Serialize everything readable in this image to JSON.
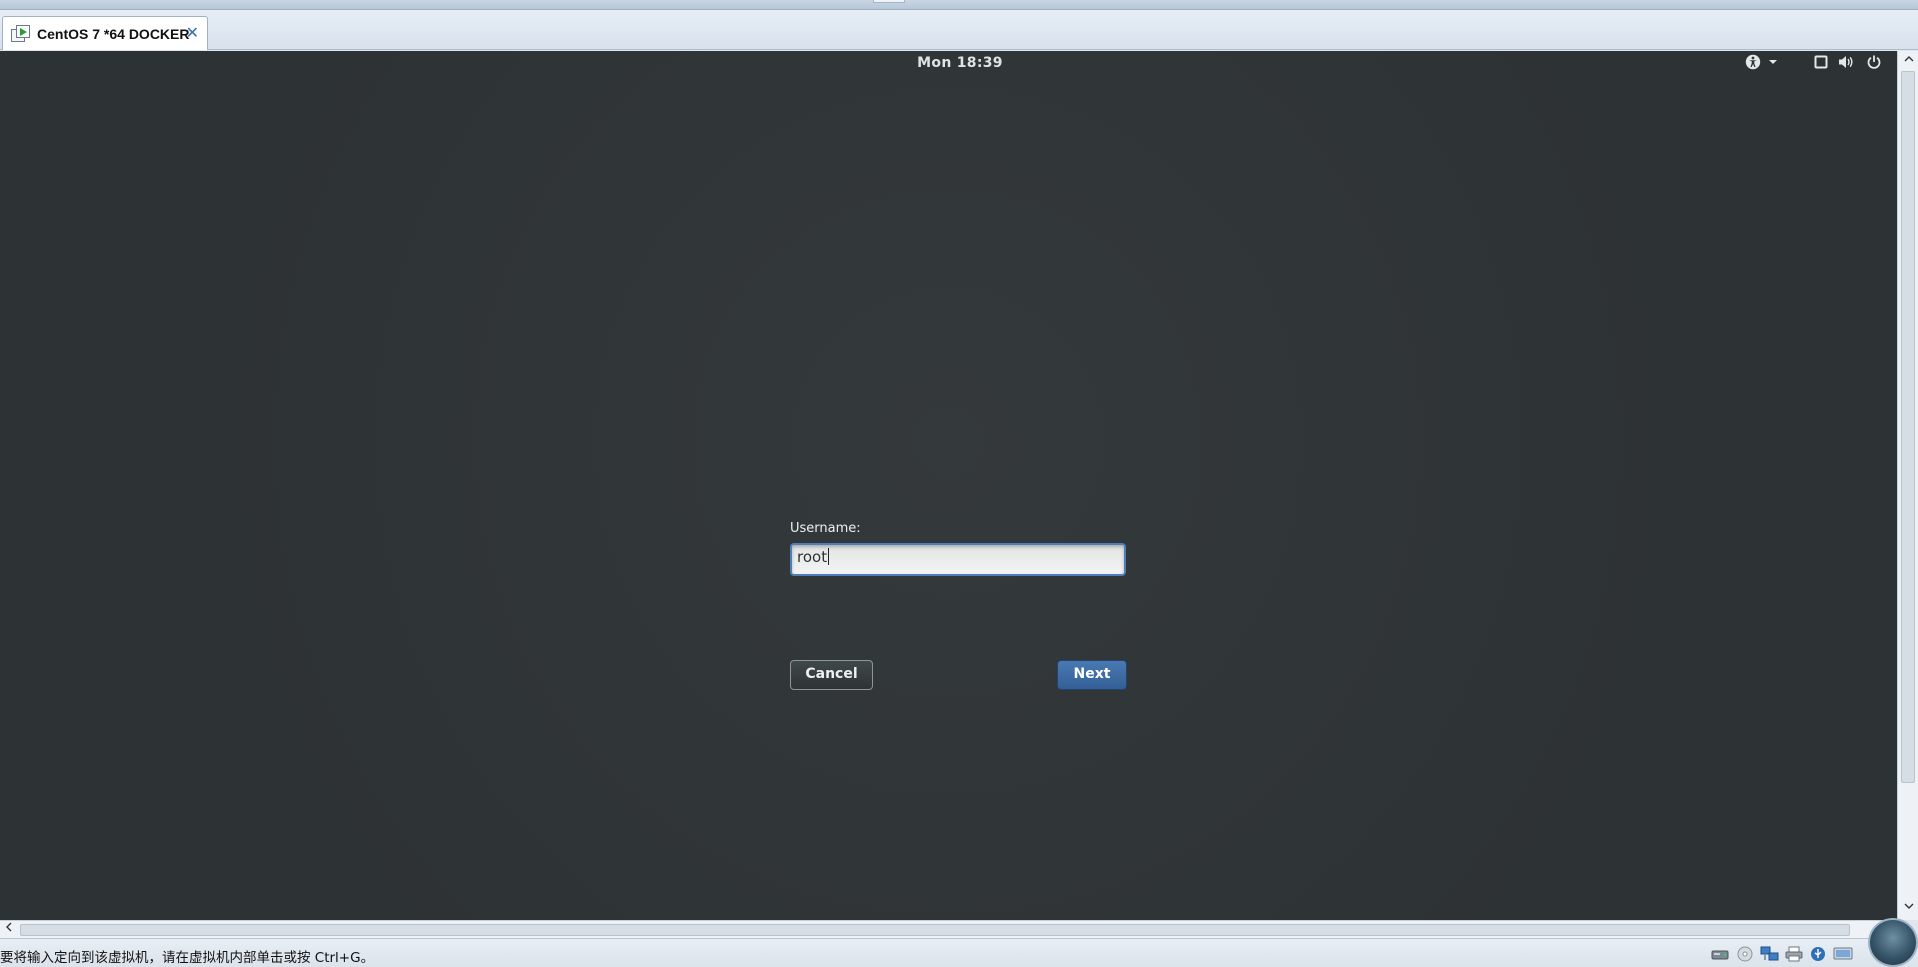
{
  "window": {
    "tab_title": "CentOS 7 *64 DOCKER",
    "tab_close_glyph": "✕"
  },
  "guest": {
    "panel": {
      "clock": "Mon 18:39",
      "icons": [
        "accessibility-icon",
        "dropdown-arrow-icon",
        "display-icon",
        "volume-icon",
        "power-icon"
      ]
    },
    "login": {
      "username_label": "Username:",
      "username_value": "root",
      "cancel_label": "Cancel",
      "next_label": "Next"
    }
  },
  "status_bar": {
    "hint": "要将输入定向到该虚拟机，请在虚拟机内部单击或按 Ctrl+G。",
    "device_icons": [
      "hard-disk-icon",
      "cd-rom-icon",
      "network-icon",
      "printer-icon",
      "usb-icon",
      "display-adapter-icon"
    ]
  },
  "colors": {
    "guest_background": "#2f3436",
    "accent": "#4d7fbc",
    "next_button": "#3d6aa2"
  }
}
